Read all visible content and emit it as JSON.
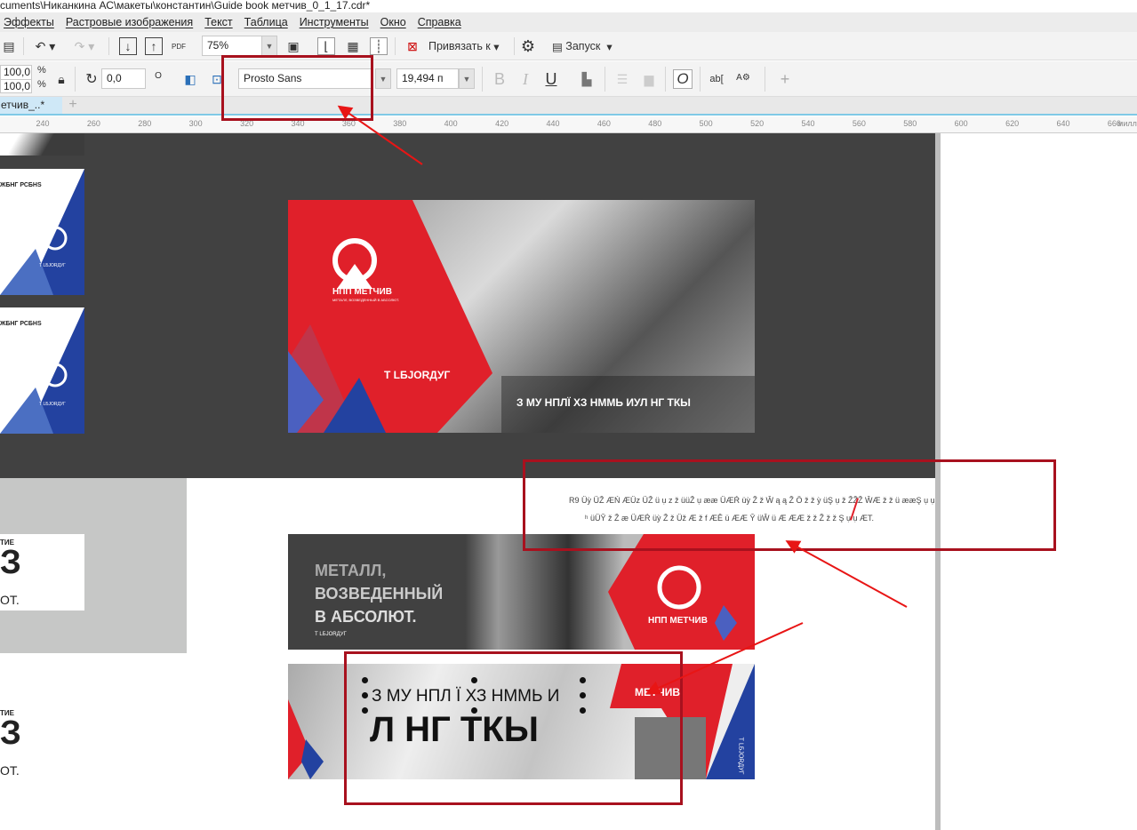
{
  "window": {
    "title": "cuments\\Никанкина АС\\макеты\\константин\\Guide book метчив_0_1_17.cdr*"
  },
  "menu": [
    "Эффекты",
    "Растровые изображения",
    "Текст",
    "Таблица",
    "Инструменты",
    "Окно",
    "Справка"
  ],
  "toolbar": {
    "zoom": "75%",
    "snap_label": "Привязать к",
    "launch_label": "Запуск",
    "pdf_label": "PDF"
  },
  "propbar": {
    "scale_x": "100,0",
    "scale_y": "100,0",
    "percent": "%",
    "rotation": "0,0",
    "degree": "O",
    "font_name": "Prosto Sans",
    "font_size": "19,494 п",
    "bold": "B",
    "italic": "I",
    "underline": "U",
    "outline_o": "O",
    "ab": "ab",
    "a_gear": "A",
    "add": "+"
  },
  "tabs": [
    {
      "label": "етчив_..*"
    }
  ],
  "ruler": {
    "ticks": [
      "240",
      "260",
      "280",
      "300",
      "320",
      "340",
      "360",
      "380",
      "400",
      "420",
      "440",
      "460",
      "480",
      "500",
      "520",
      "540",
      "560",
      "580",
      "600",
      "620",
      "640",
      "660"
    ],
    "unit": "милл"
  },
  "thumbnails": {
    "heading": "ЖБНГ РСБНЅ",
    "footer": "Т LБЈОRДУГ",
    "side_top": "ТИЕ",
    "side_big": "З",
    "side_bottom": "ОТ."
  },
  "banner1": {
    "brand": "НПП МЕТЧИВ",
    "tagline": "МЕТАЛЛ, ВОЗВЕДЕННЫЙ В АБСОЛЮТ.",
    "code": "Т LБЈОRДУГ",
    "caption": "З МУ НПЛЇ ХЗ НММЬ ИУЛ НГ ТКЫ"
  },
  "garbled": {
    "line1": "R9 Üỳ ÜŽ ÆŃ ÆÜz ÜŽ ü ụ z ž üüŽ ụ ææ ÜÆŔ üỳ Ž ž Ŵ ą ą Ž Ö ž ž ỳ üŞ ụ ž ŽŽŽ ŴÆ ž ž ü ææŞ ụ ụ",
    "line2": "ʰ üÜŶ ž Ž æ ÜÆŔ üỳ Ž ž Üž Æ ž f ÆĚ ü ÆÆ Ŷ üŴ ü Æ ÆÆ ž ž Ž ž ž Ş ụ ụ ÆT."
  },
  "banner2": {
    "line1": "МЕТАЛЛ,",
    "line2": "ВОЗВЕДЕННЫЙ",
    "line3": "В АБСОЛЮТ.",
    "code": "Т LБЈОRДУГ",
    "brand": "НПП МЕТЧИВ"
  },
  "banner3": {
    "line1": "З МУ НПЛ Ї ХЗ НММЬ И",
    "line2": "Л НГ ТКЫ",
    "brand": "МЕТЧИВ",
    "vertical": "Т LБЈОRДУГ"
  },
  "colors": {
    "red": "#e0202a",
    "blue": "#2342a0",
    "dark": "#414141",
    "annotation": "#a8111e",
    "arrow": "#e81515"
  }
}
